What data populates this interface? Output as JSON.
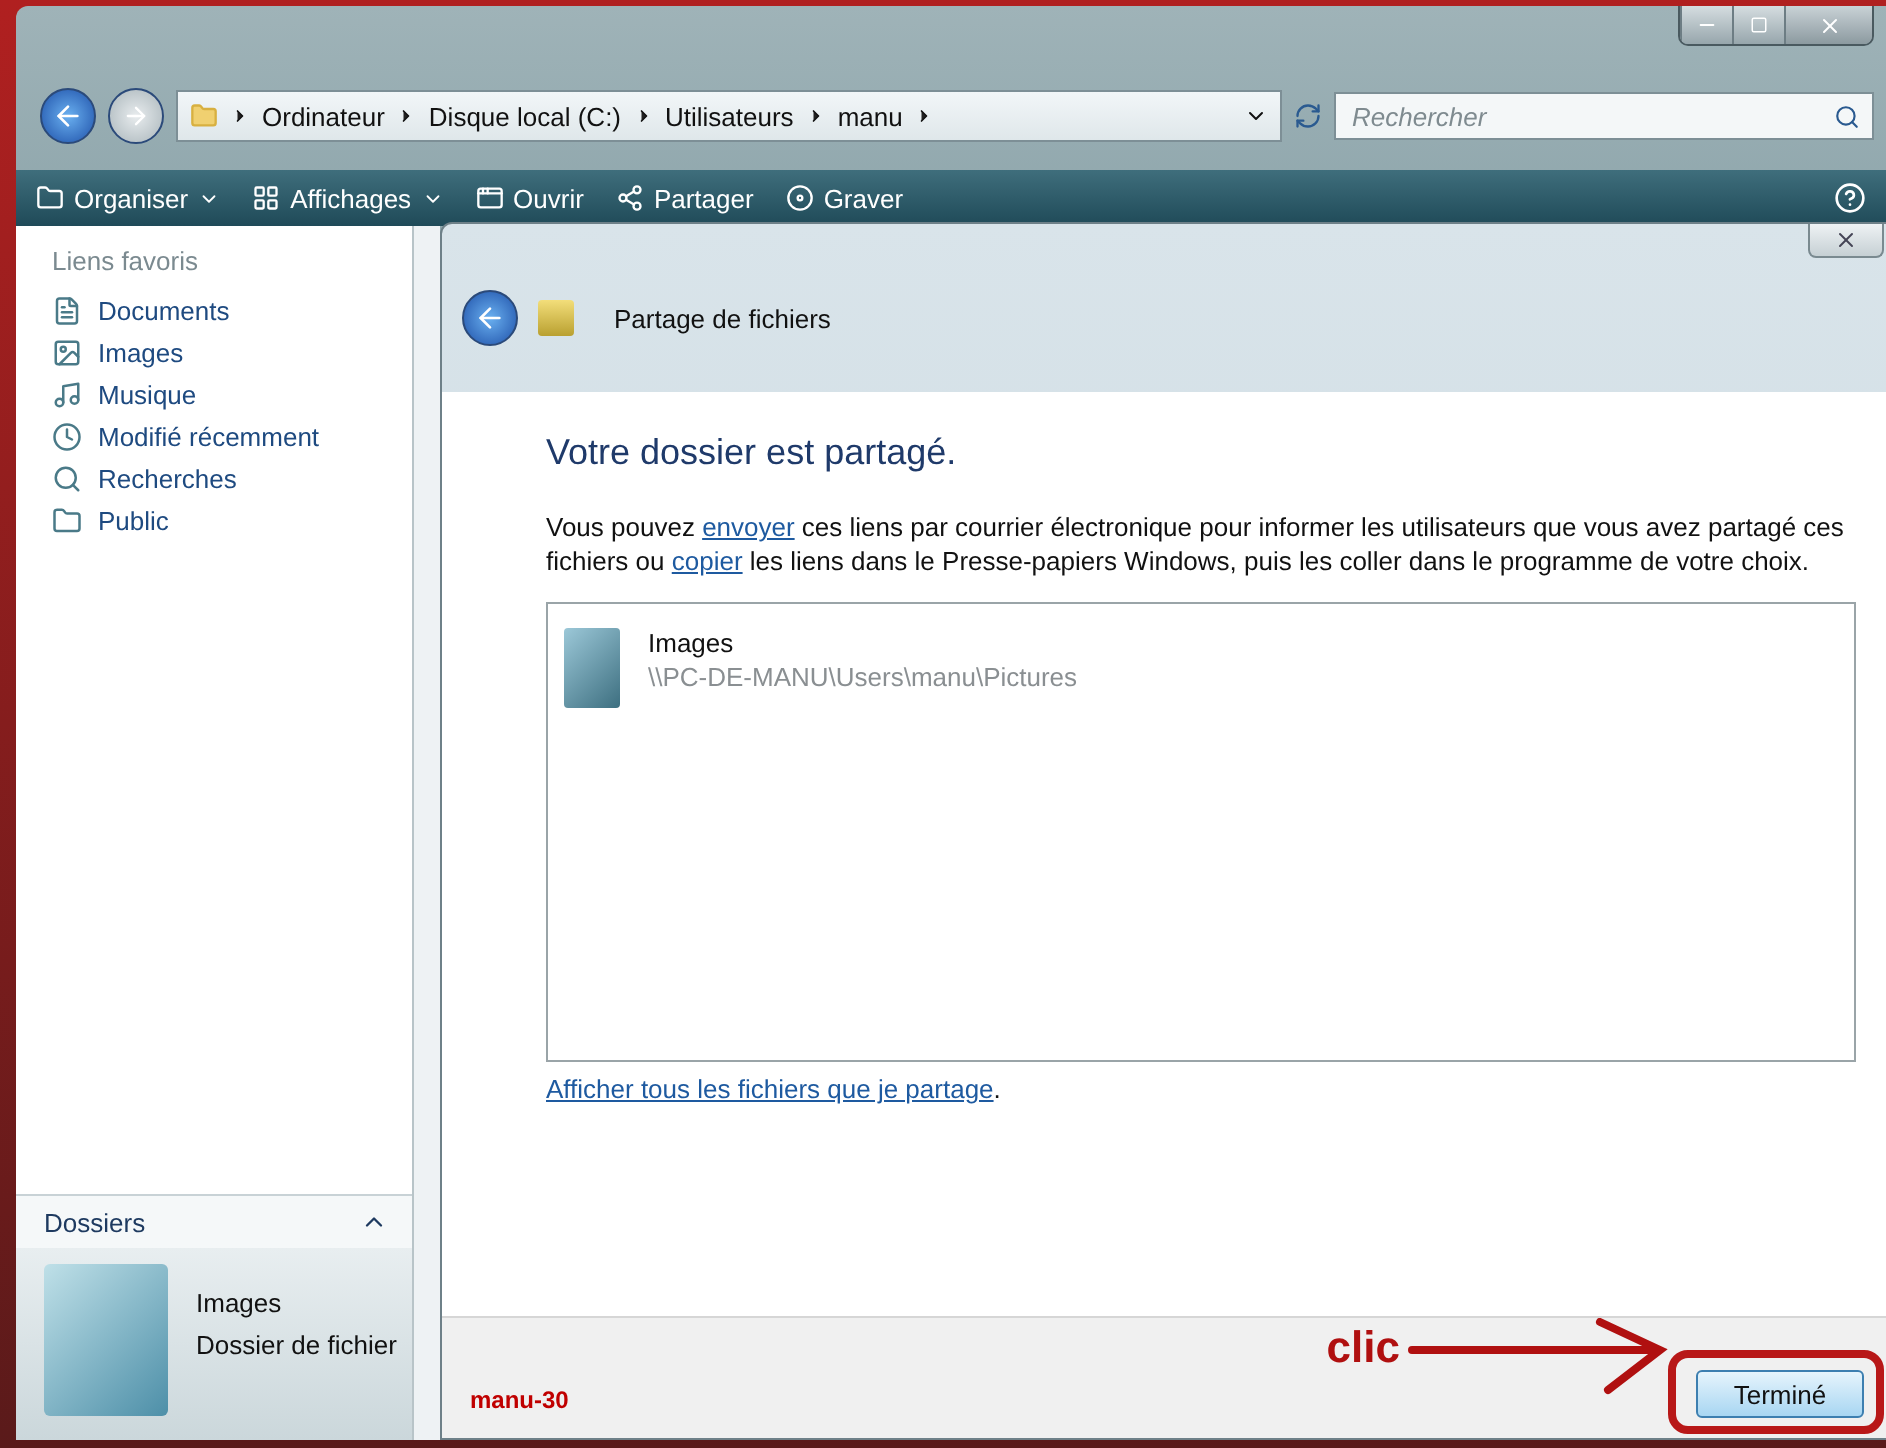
{
  "address": {
    "path": [
      "Ordinateur",
      "Disque local (C:)",
      "Utilisateurs",
      "manu"
    ],
    "search": {
      "placeholder": "Rechercher"
    }
  },
  "toolbar": [
    {
      "label": "Organiser",
      "kind": "menu"
    },
    {
      "label": "Affichages",
      "kind": "menu"
    },
    {
      "label": "Ouvrir",
      "kind": "plain"
    },
    {
      "label": "Partager",
      "kind": "plain"
    },
    {
      "label": "Graver",
      "kind": "plain"
    }
  ],
  "sidebar": {
    "title": "Liens favoris",
    "items": [
      "Documents",
      "Images",
      "Musique",
      "Modifié récemment",
      "Recherches",
      "Public"
    ],
    "folders_label": "Dossiers"
  },
  "details": {
    "name": "Images",
    "type": "Dossier de fichier"
  },
  "dialog": {
    "title": "Partage de fichiers",
    "heading": "Votre dossier est partagé.",
    "message": [
      {
        "kind": "text",
        "text": "Vous pouvez "
      },
      {
        "kind": "link",
        "text": "envoyer"
      },
      {
        "kind": "text",
        "text": " ces liens par courrier électronique pour informer les utilisateurs que vous avez partagé ces fichiers ou "
      },
      {
        "kind": "link",
        "text": "copier"
      },
      {
        "kind": "text",
        "text": " les liens dans le Presse-papiers Windows, puis les coller dans le programme de votre choix."
      }
    ],
    "shared_items": [
      {
        "name": "Images",
        "path": "\\\\PC-DE-MANU\\Users\\manu\\Pictures"
      }
    ],
    "footer_link": [
      {
        "kind": "link",
        "text": "Afficher tous les fichiers que je partage"
      },
      {
        "kind": "text",
        "text": "."
      }
    ],
    "button": "Terminé"
  },
  "annotations": {
    "tag": "manu-30",
    "callout": "clic"
  }
}
